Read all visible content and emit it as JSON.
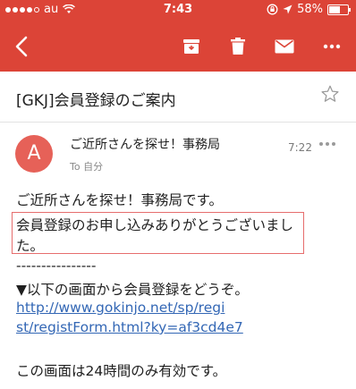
{
  "status_bar": {
    "carrier": "au",
    "time": "7:43",
    "battery_percent": "58%",
    "battery_level": 0.58
  },
  "toolbar": {
    "icons": [
      "back-arrow-icon",
      "archive-icon",
      "trash-icon",
      "mail-icon",
      "more-icon"
    ]
  },
  "email": {
    "subject": "[GKJ]会員登録のご案内",
    "sender": "ご近所さんを探せ！事務局",
    "recipient": "To 自分",
    "time": "7:22",
    "avatar_letter": "A",
    "body": {
      "line1": "ご近所さんを探せ！事務局です。",
      "line2": "会員登録のお申し込みありがとうございまし",
      "line3": "た。",
      "separator": "----------------",
      "line4": "▼以下の画面から会員登録をどうぞ。",
      "link_line1": "http://www.gokinjo.net/sp/regi",
      "link_line2": "st/registForm.html?ky=af3cd4e7",
      "line5": "この画面は24時間のみ有効です。"
    }
  },
  "colors": {
    "appbar": "#dc4437",
    "avatar": "#e66158",
    "link": "#3367b5",
    "highlight_border": "#e66d6d"
  }
}
